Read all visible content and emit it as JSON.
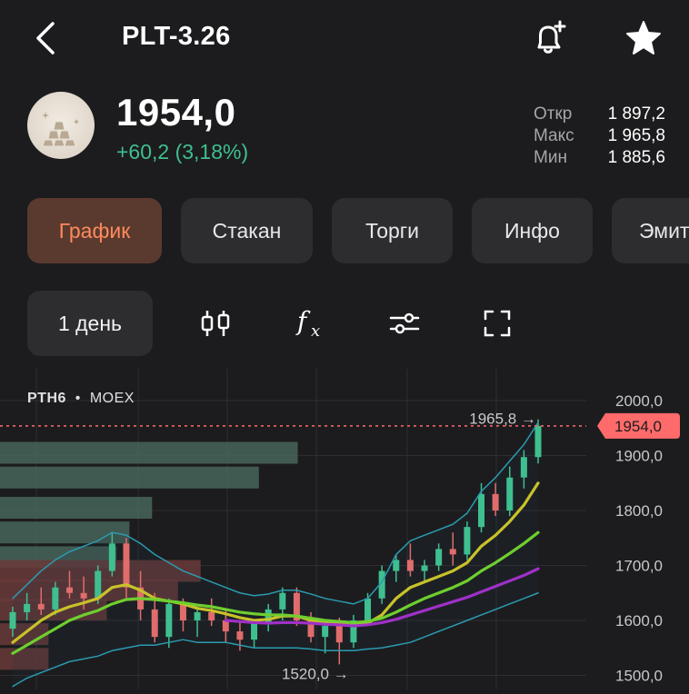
{
  "header": {
    "title": "PLT-3.26",
    "icons": {
      "back": "chevron-left-icon",
      "alert": "bell-plus-icon",
      "favorite": "star-icon"
    }
  },
  "quote": {
    "price": "1954,0",
    "change": "+60,2 (3,18%)",
    "change_color": "#3fbf8f",
    "stats": [
      {
        "label": "Откр",
        "value": "1 897,2"
      },
      {
        "label": "Макс",
        "value": "1 965,8"
      },
      {
        "label": "Мин",
        "value": "1 885,6"
      }
    ]
  },
  "tabs": [
    {
      "label": "График",
      "active": true
    },
    {
      "label": "Стакан",
      "active": false
    },
    {
      "label": "Торги",
      "active": false
    },
    {
      "label": "Инфо",
      "active": false
    },
    {
      "label": "Эмит",
      "active": false
    }
  ],
  "toolbar": {
    "period_label": "1 день",
    "icons": [
      "candles-icon",
      "function-icon",
      "settings-sliders-icon",
      "fullscreen-icon"
    ]
  },
  "chart_data": {
    "type": "candlestick",
    "ticker": "PTH6",
    "exchange": "MOEX",
    "y_ticks": [
      "2000,0",
      "1900,0",
      "1800,0",
      "1700,0",
      "1600,0",
      "1500,0"
    ],
    "ylim": [
      1490,
      2020
    ],
    "current_price_label": "1954,0",
    "current_price": 1954,
    "max_label": "1965,8 →",
    "max_value": 1965.8,
    "min_label": "1520,0 →",
    "min_value": 1520,
    "grid": true,
    "candles": [
      {
        "o": 1585,
        "h": 1625,
        "l": 1570,
        "c": 1615
      },
      {
        "o": 1615,
        "h": 1650,
        "l": 1600,
        "c": 1630
      },
      {
        "o": 1630,
        "h": 1660,
        "l": 1610,
        "c": 1620
      },
      {
        "o": 1620,
        "h": 1670,
        "l": 1610,
        "c": 1660
      },
      {
        "o": 1660,
        "h": 1690,
        "l": 1640,
        "c": 1650
      },
      {
        "o": 1650,
        "h": 1680,
        "l": 1620,
        "c": 1640
      },
      {
        "o": 1640,
        "h": 1700,
        "l": 1630,
        "c": 1690
      },
      {
        "o": 1690,
        "h": 1760,
        "l": 1680,
        "c": 1740
      },
      {
        "o": 1740,
        "h": 1750,
        "l": 1640,
        "c": 1660
      },
      {
        "o": 1660,
        "h": 1690,
        "l": 1600,
        "c": 1620
      },
      {
        "o": 1620,
        "h": 1650,
        "l": 1560,
        "c": 1570
      },
      {
        "o": 1570,
        "h": 1640,
        "l": 1550,
        "c": 1630
      },
      {
        "o": 1630,
        "h": 1640,
        "l": 1580,
        "c": 1600
      },
      {
        "o": 1600,
        "h": 1625,
        "l": 1570,
        "c": 1615
      },
      {
        "o": 1615,
        "h": 1640,
        "l": 1590,
        "c": 1600
      },
      {
        "o": 1600,
        "h": 1620,
        "l": 1560,
        "c": 1580
      },
      {
        "o": 1580,
        "h": 1600,
        "l": 1545,
        "c": 1565
      },
      {
        "o": 1565,
        "h": 1600,
        "l": 1550,
        "c": 1595
      },
      {
        "o": 1595,
        "h": 1630,
        "l": 1580,
        "c": 1620
      },
      {
        "o": 1620,
        "h": 1660,
        "l": 1600,
        "c": 1650
      },
      {
        "o": 1650,
        "h": 1660,
        "l": 1590,
        "c": 1600
      },
      {
        "o": 1600,
        "h": 1615,
        "l": 1560,
        "c": 1570
      },
      {
        "o": 1570,
        "h": 1600,
        "l": 1540,
        "c": 1590
      },
      {
        "o": 1590,
        "h": 1605,
        "l": 1520,
        "c": 1560
      },
      {
        "o": 1560,
        "h": 1610,
        "l": 1550,
        "c": 1600
      },
      {
        "o": 1600,
        "h": 1650,
        "l": 1595,
        "c": 1640
      },
      {
        "o": 1640,
        "h": 1700,
        "l": 1630,
        "c": 1690
      },
      {
        "o": 1690,
        "h": 1720,
        "l": 1670,
        "c": 1710
      },
      {
        "o": 1710,
        "h": 1740,
        "l": 1680,
        "c": 1690
      },
      {
        "o": 1690,
        "h": 1710,
        "l": 1670,
        "c": 1700
      },
      {
        "o": 1700,
        "h": 1740,
        "l": 1690,
        "c": 1730
      },
      {
        "o": 1730,
        "h": 1760,
        "l": 1700,
        "c": 1720
      },
      {
        "o": 1720,
        "h": 1780,
        "l": 1710,
        "c": 1770
      },
      {
        "o": 1770,
        "h": 1850,
        "l": 1760,
        "c": 1830
      },
      {
        "o": 1830,
        "h": 1850,
        "l": 1790,
        "c": 1800
      },
      {
        "o": 1800,
        "h": 1880,
        "l": 1790,
        "c": 1860
      },
      {
        "o": 1860,
        "h": 1910,
        "l": 1840,
        "c": 1897.2
      },
      {
        "o": 1897.2,
        "h": 1965.8,
        "l": 1885.6,
        "c": 1954
      }
    ],
    "series": [
      {
        "color": "#c8c22a",
        "values": [
          1560,
          1580,
          1600,
          1615,
          1625,
          1632,
          1640,
          1660,
          1665,
          1655,
          1640,
          1635,
          1630,
          1622,
          1618,
          1612,
          1605,
          1600,
          1602,
          1608,
          1608,
          1600,
          1595,
          1594,
          1590,
          1595,
          1610,
          1640,
          1660,
          1670,
          1680,
          1690,
          1705,
          1735,
          1755,
          1780,
          1810,
          1850
        ]
      },
      {
        "color": "#6fcf2e",
        "values": [
          1540,
          1555,
          1570,
          1585,
          1600,
          1610,
          1618,
          1630,
          1638,
          1640,
          1638,
          1635,
          1632,
          1628,
          1625,
          1620,
          1615,
          1612,
          1610,
          1610,
          1608,
          1604,
          1600,
          1598,
          1596,
          1598,
          1604,
          1615,
          1628,
          1640,
          1650,
          1660,
          1672,
          1690,
          1705,
          1722,
          1740,
          1760
        ]
      },
      {
        "color": "#a030c8",
        "values": [
          null,
          null,
          null,
          null,
          null,
          null,
          null,
          null,
          null,
          null,
          null,
          null,
          null,
          null,
          null,
          1600,
          1598,
          1596,
          1595,
          1596,
          1596,
          1595,
          1593,
          1592,
          1590,
          1592,
          1596,
          1602,
          1610,
          1618,
          1626,
          1634,
          1642,
          1652,
          1662,
          1672,
          1682,
          1694
        ]
      },
      {
        "color": "#2a9bb0",
        "values": [
          1640,
          1665,
          1690,
          1710,
          1725,
          1735,
          1745,
          1760,
          1755,
          1740,
          1720,
          1705,
          1690,
          1680,
          1670,
          1660,
          1650,
          1645,
          1648,
          1655,
          1655,
          1648,
          1640,
          1635,
          1630,
          1640,
          1670,
          1720,
          1745,
          1755,
          1765,
          1775,
          1795,
          1835,
          1860,
          1890,
          1920,
          1960
        ]
      },
      {
        "color": "#2a9bb0",
        "values": [
          1480,
          1495,
          1505,
          1515,
          1525,
          1530,
          1535,
          1545,
          1550,
          1555,
          1555,
          1560,
          1565,
          1560,
          1560,
          1560,
          1555,
          1550,
          1550,
          1550,
          1550,
          1548,
          1545,
          1545,
          1545,
          1548,
          1550,
          1555,
          1560,
          1570,
          1580,
          1590,
          1600,
          1610,
          1620,
          1630,
          1640,
          1650
        ]
      }
    ],
    "volume_profile": [
      {
        "price": 1905,
        "size": 0.92,
        "color": "#48655a"
      },
      {
        "price": 1860,
        "size": 0.8,
        "color": "#48655a"
      },
      {
        "price": 1805,
        "size": 0.47,
        "color": "#48655a"
      },
      {
        "price": 1760,
        "size": 0.4,
        "color": "#48655a"
      },
      {
        "price": 1715,
        "size": 0.36,
        "color": "#48655a"
      },
      {
        "price": 1690,
        "size": 0.62,
        "color": "#6a3a3a"
      },
      {
        "price": 1655,
        "size": 0.55,
        "color": "#6a3a3a"
      },
      {
        "price": 1620,
        "size": 0.33,
        "color": "#6a3a3a"
      },
      {
        "price": 1575,
        "size": 0.15,
        "color": "#6a3a3a"
      },
      {
        "price": 1530,
        "size": 0.15,
        "color": "#6a3a3a"
      }
    ],
    "up_color": "#3fbf8f",
    "down_color": "#e06c6c",
    "price_tag_color": "#ff6b6b"
  }
}
